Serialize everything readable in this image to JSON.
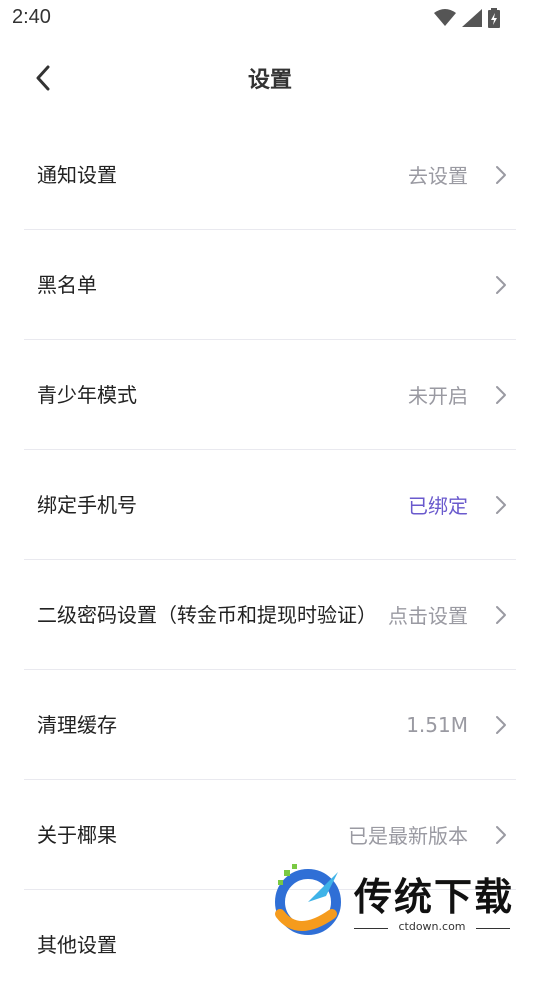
{
  "status": {
    "time": "2:40"
  },
  "nav": {
    "title": "设置"
  },
  "rows": [
    {
      "label": "通知设置",
      "value": "去设置"
    },
    {
      "label": "黑名单",
      "value": ""
    },
    {
      "label": "青少年模式",
      "value": "未开启"
    },
    {
      "label": "绑定手机号",
      "value": "已绑定"
    },
    {
      "label": "二级密码设置（转金币和提现时验证）",
      "value": "点击设置"
    },
    {
      "label": "清理缓存",
      "value": "1.51M"
    },
    {
      "label": "关于椰果",
      "value": "已是最新版本"
    },
    {
      "label": "其他设置",
      "value": ""
    }
  ],
  "colors": {
    "accent": "#6a5acd",
    "muted": "#9a9aa2"
  },
  "watermark": {
    "text": "传统下载",
    "url": "ctdown.com"
  }
}
